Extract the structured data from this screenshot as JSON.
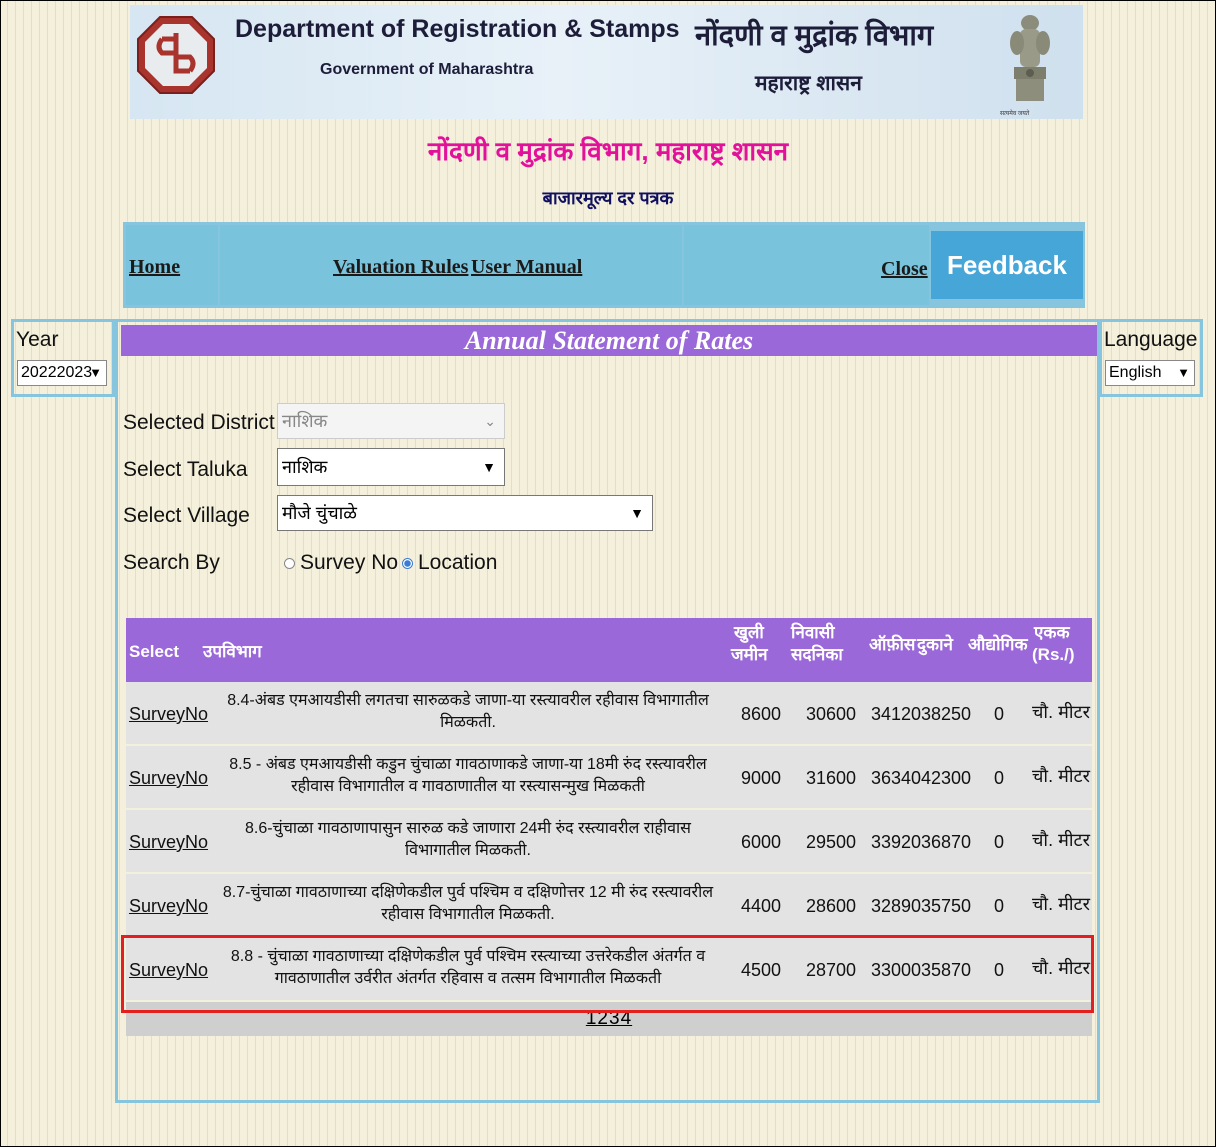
{
  "header": {
    "dept_en": "Department of Registration & Stamps",
    "gov_en": "Government of Maharashtra",
    "dept_mr": "नोंदणी व मुद्रांक विभाग",
    "gov_mr": "महाराष्ट्र शासन",
    "emblem_caption": "सत्यमेव जयते"
  },
  "subtitle": "नोंदणी व मुद्रांक विभाग, महाराष्ट्र शासन",
  "sub_heading": "बाजारमूल्य दर पत्रक",
  "nav": {
    "home": "Home",
    "valuation_rules": "Valuation Rules",
    "user_manual": "User Manual",
    "close": "Close",
    "feedback": "Feedback"
  },
  "year": {
    "label": "Year",
    "value": "20222023"
  },
  "language": {
    "label": "Language",
    "value": "English"
  },
  "panel_title": "Annual Statement of Rates",
  "form": {
    "district_label": "Selected District",
    "district_value": "नाशिक",
    "taluka_label": "Select Taluka",
    "taluka_value": "नाशिक",
    "village_label": "Select Village",
    "village_value": "मौजे चुंचाळे",
    "search_by_label": "Search By",
    "option_survey": "Survey No",
    "option_location": "Location",
    "selected_option": "Location"
  },
  "table": {
    "headers": {
      "select": "Select",
      "subdivision": "उपविभाग",
      "open_land": [
        "खुली",
        "जमीन"
      ],
      "residential": [
        "निवासी",
        "सदनिका"
      ],
      "office": "ऑफ़ीस",
      "shops": "दुकाने",
      "industrial": "औद्योगिक",
      "unit": [
        "एकक",
        "(Rs./)"
      ]
    },
    "rows": [
      {
        "link": "SurveyNo",
        "desc": "8.4-अंबड एमआयडीसी लगतचा सारुळकडे जाणा-या रस्त्यावरील रहीवास विभागातील मिळकती.",
        "open_land": "8600",
        "residential": "30600",
        "office": "34120",
        "shops": "38250",
        "industrial": "0",
        "unit": "चौ. मीटर"
      },
      {
        "link": "SurveyNo",
        "desc": "8.5 - अंबड एमआयडीसी कडुन चुंचाळा गावठाणाकडे जाणा-या 18मी रुंद रस्त्यावरील रहीवास विभागातील व गावठाणातील या रस्त्यासन्मुख मिळकती",
        "open_land": "9000",
        "residential": "31600",
        "office": "36340",
        "shops": "42300",
        "industrial": "0",
        "unit": "चौ. मीटर"
      },
      {
        "link": "SurveyNo",
        "desc": "8.6-चुंचाळा गावठाणापासुन सारुळ कडे जाणारा 24मी रुंद रस्त्यावरील राहीवास विभागातील मिळकती.",
        "open_land": "6000",
        "residential": "29500",
        "office": "33920",
        "shops": "36870",
        "industrial": "0",
        "unit": "चौ. मीटर"
      },
      {
        "link": "SurveyNo",
        "desc": "8.7-चुंचाळा गावठाणाच्या दक्षिणेकडील पुर्व पश्चिम व दक्षिणोत्तर 12 मी रुंद रस्त्यावरील रहीवास विभागातील मिळकती.",
        "open_land": "4400",
        "residential": "28600",
        "office": "32890",
        "shops": "35750",
        "industrial": "0",
        "unit": "चौ. मीटर"
      },
      {
        "link": "SurveyNo",
        "desc": "8.8 - चुंचाळा गावठाणाच्या दक्षिणेकडील पुर्व पश्चिम रस्त्याच्या उत्तरेकडील अंतर्गत व गावठाणातील उर्वरीत अंतर्गत रहिवास व तत्सम विभागातील मिळकती",
        "open_land": "4500",
        "residential": "28700",
        "office": "33000",
        "shops": "35870",
        "industrial": "0",
        "unit": "चौ. मीटर"
      }
    ],
    "pages": [
      "1",
      "2",
      "3",
      "4"
    ],
    "highlighted_row": 5
  },
  "colors": {
    "page_bg": "#f5f0dc",
    "nav_bg": "#86c5dd",
    "feedback_bg": "#47a6d8",
    "header_purple": "#9a68d8",
    "subtitle_magenta": "#e2119a",
    "highlight_red": "#e41f1f"
  },
  "icons": [
    "department-logo-icon",
    "state-emblem-icon",
    "chevron-down-icon"
  ]
}
